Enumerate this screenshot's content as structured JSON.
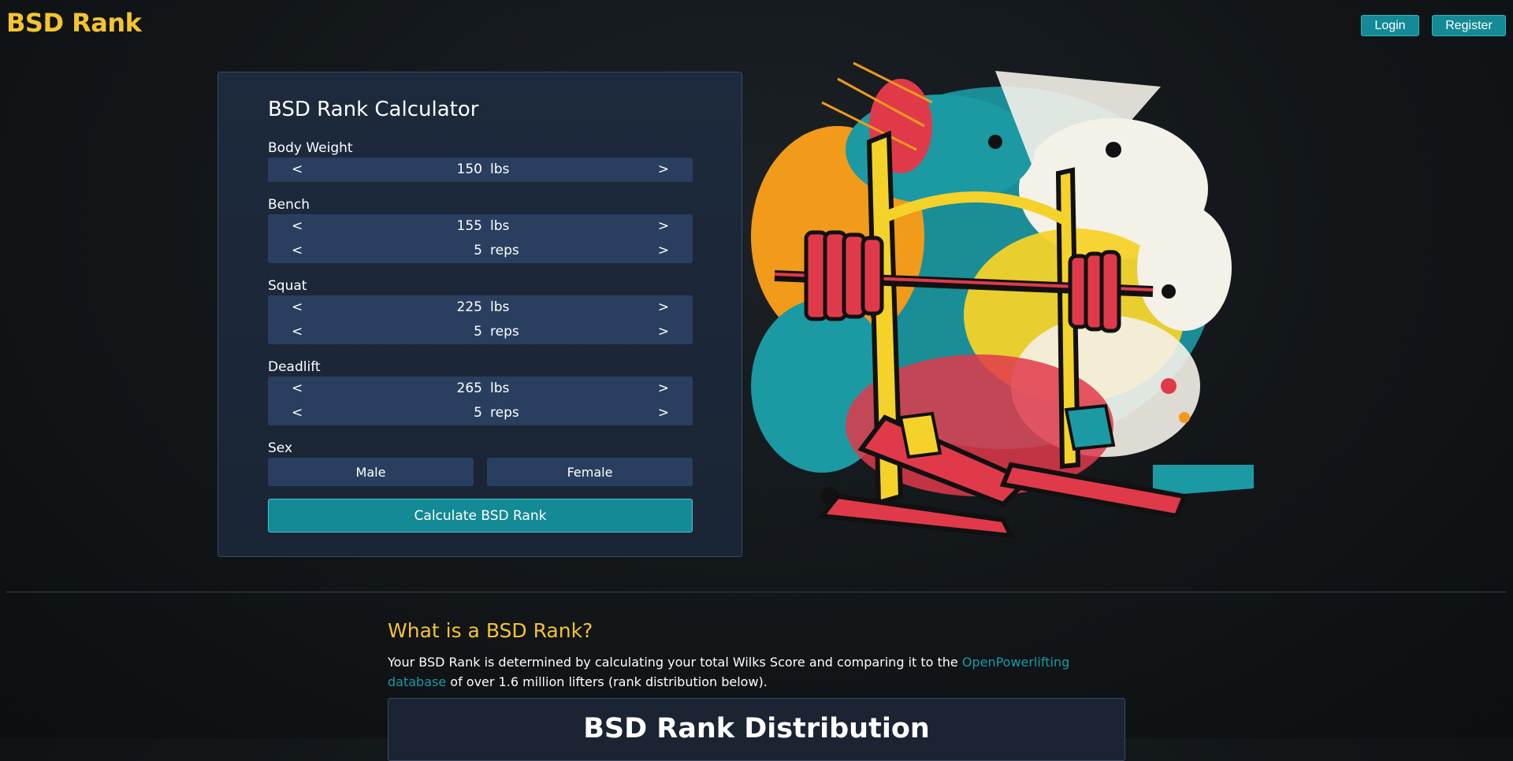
{
  "brand": {
    "title": "BSD Rank"
  },
  "header": {
    "login_label": "Login",
    "register_label": "Register"
  },
  "calculator": {
    "title": "BSD Rank Calculator",
    "body_weight": {
      "label": "Body Weight",
      "value": "150",
      "unit": "lbs"
    },
    "bench": {
      "label": "Bench",
      "weight": "155",
      "weight_unit": "lbs",
      "reps": "5",
      "reps_unit": "reps"
    },
    "squat": {
      "label": "Squat",
      "weight": "225",
      "weight_unit": "lbs",
      "reps": "5",
      "reps_unit": "reps"
    },
    "deadlift": {
      "label": "Deadlift",
      "weight": "265",
      "weight_unit": "lbs",
      "reps": "5",
      "reps_unit": "reps"
    },
    "sex": {
      "label": "Sex",
      "male": "Male",
      "female": "Female"
    },
    "decrement": "<",
    "increment": ">",
    "submit_label": "Calculate BSD Rank"
  },
  "info": {
    "title": "What is a BSD Rank?",
    "text_before": "Your BSD Rank is determined by calculating your total Wilks Score and comparing it to the ",
    "link_text": "OpenPowerlifting database",
    "text_after": " of over 1.6 million lifters (rank distribution below)."
  },
  "distribution": {
    "title": "BSD Rank Distribution"
  },
  "colors": {
    "accent": "#f4c430",
    "teal": "#138a95",
    "panel": "#1d2a3d",
    "stepper": "#2a3f5f"
  },
  "icons": {
    "illustration": "squat-rack-illustration"
  }
}
